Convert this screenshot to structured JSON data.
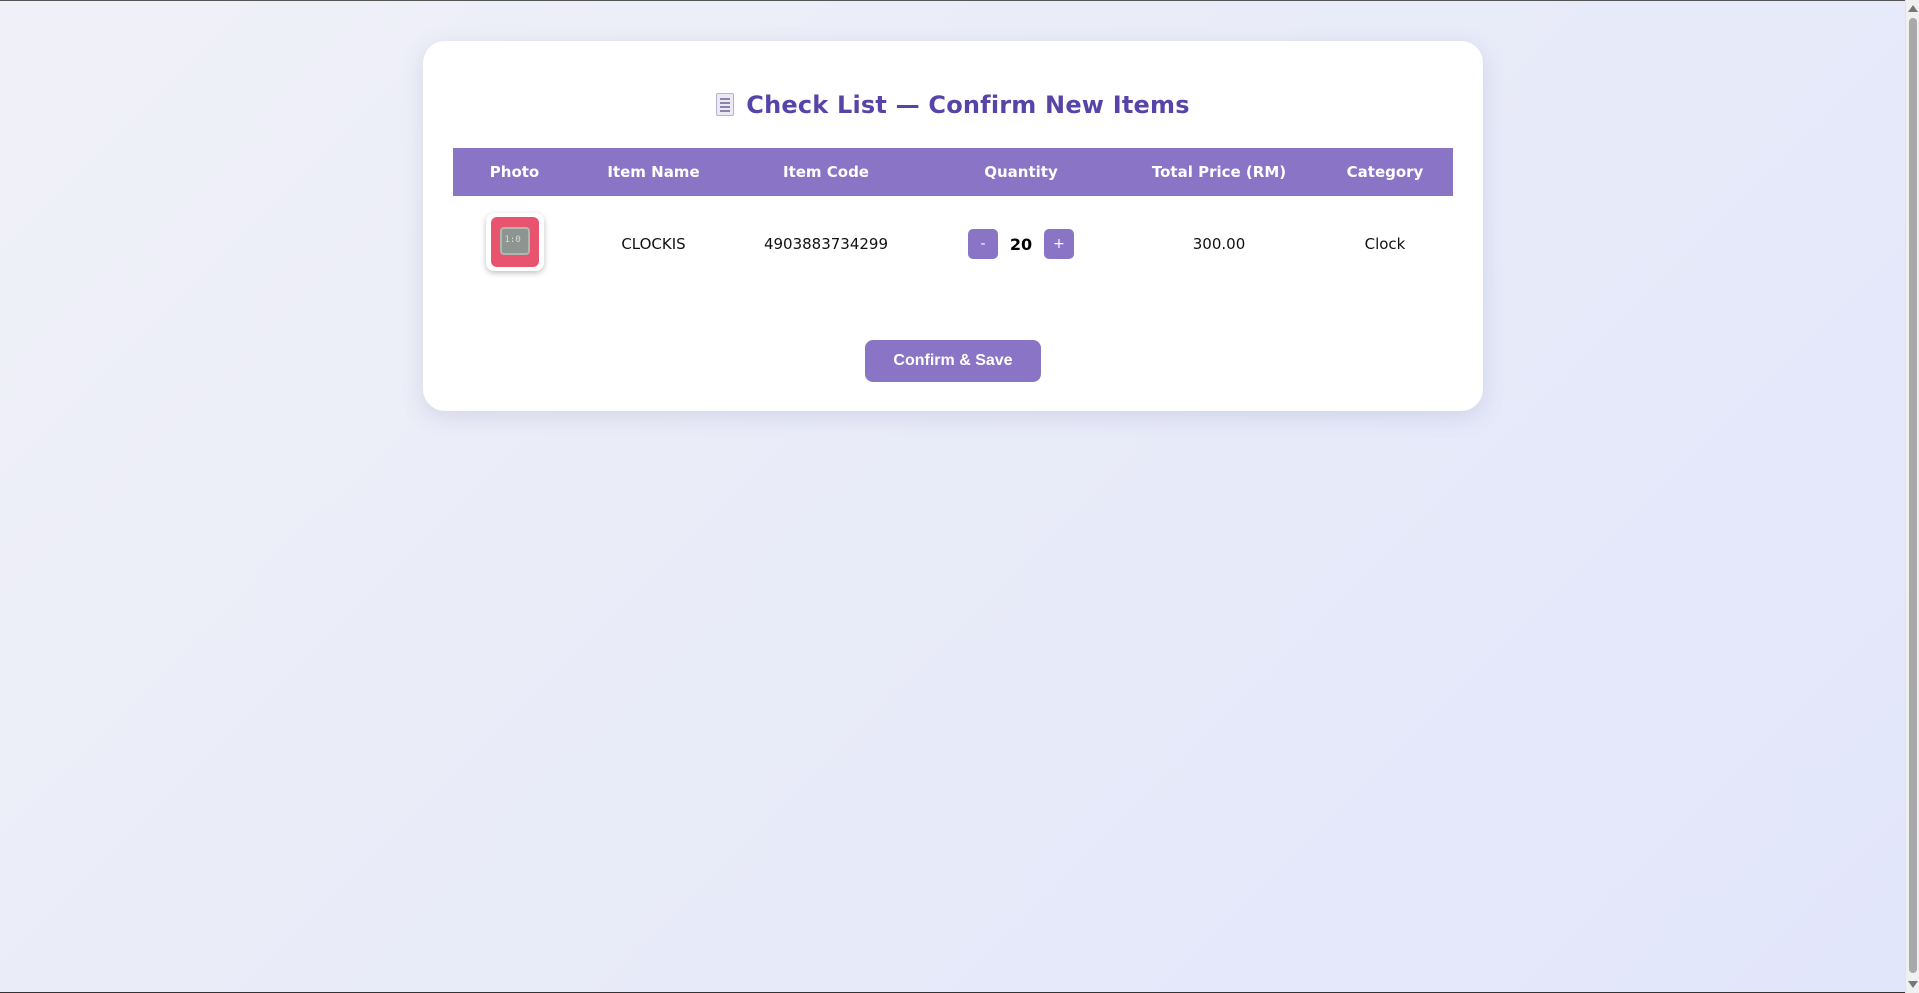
{
  "page": {
    "title": "Check List — Confirm New Items",
    "title_icon": "receipt-icon"
  },
  "table": {
    "headers": [
      "Photo",
      "Item Name",
      "Item Code",
      "Quantity",
      "Total Price (RM)",
      "Category"
    ],
    "rows": [
      {
        "photo": "clock-photo",
        "name": "CLOCKIS",
        "code": "4903883734299",
        "quantity": "20",
        "decrement_label": "-",
        "increment_label": "+",
        "total_price": "300.00",
        "category": "Clock"
      }
    ]
  },
  "actions": {
    "confirm_label": "Confirm & Save"
  },
  "colors": {
    "accent": "#8a74c6",
    "title": "#5844a8",
    "background": "#e8ebf8"
  }
}
